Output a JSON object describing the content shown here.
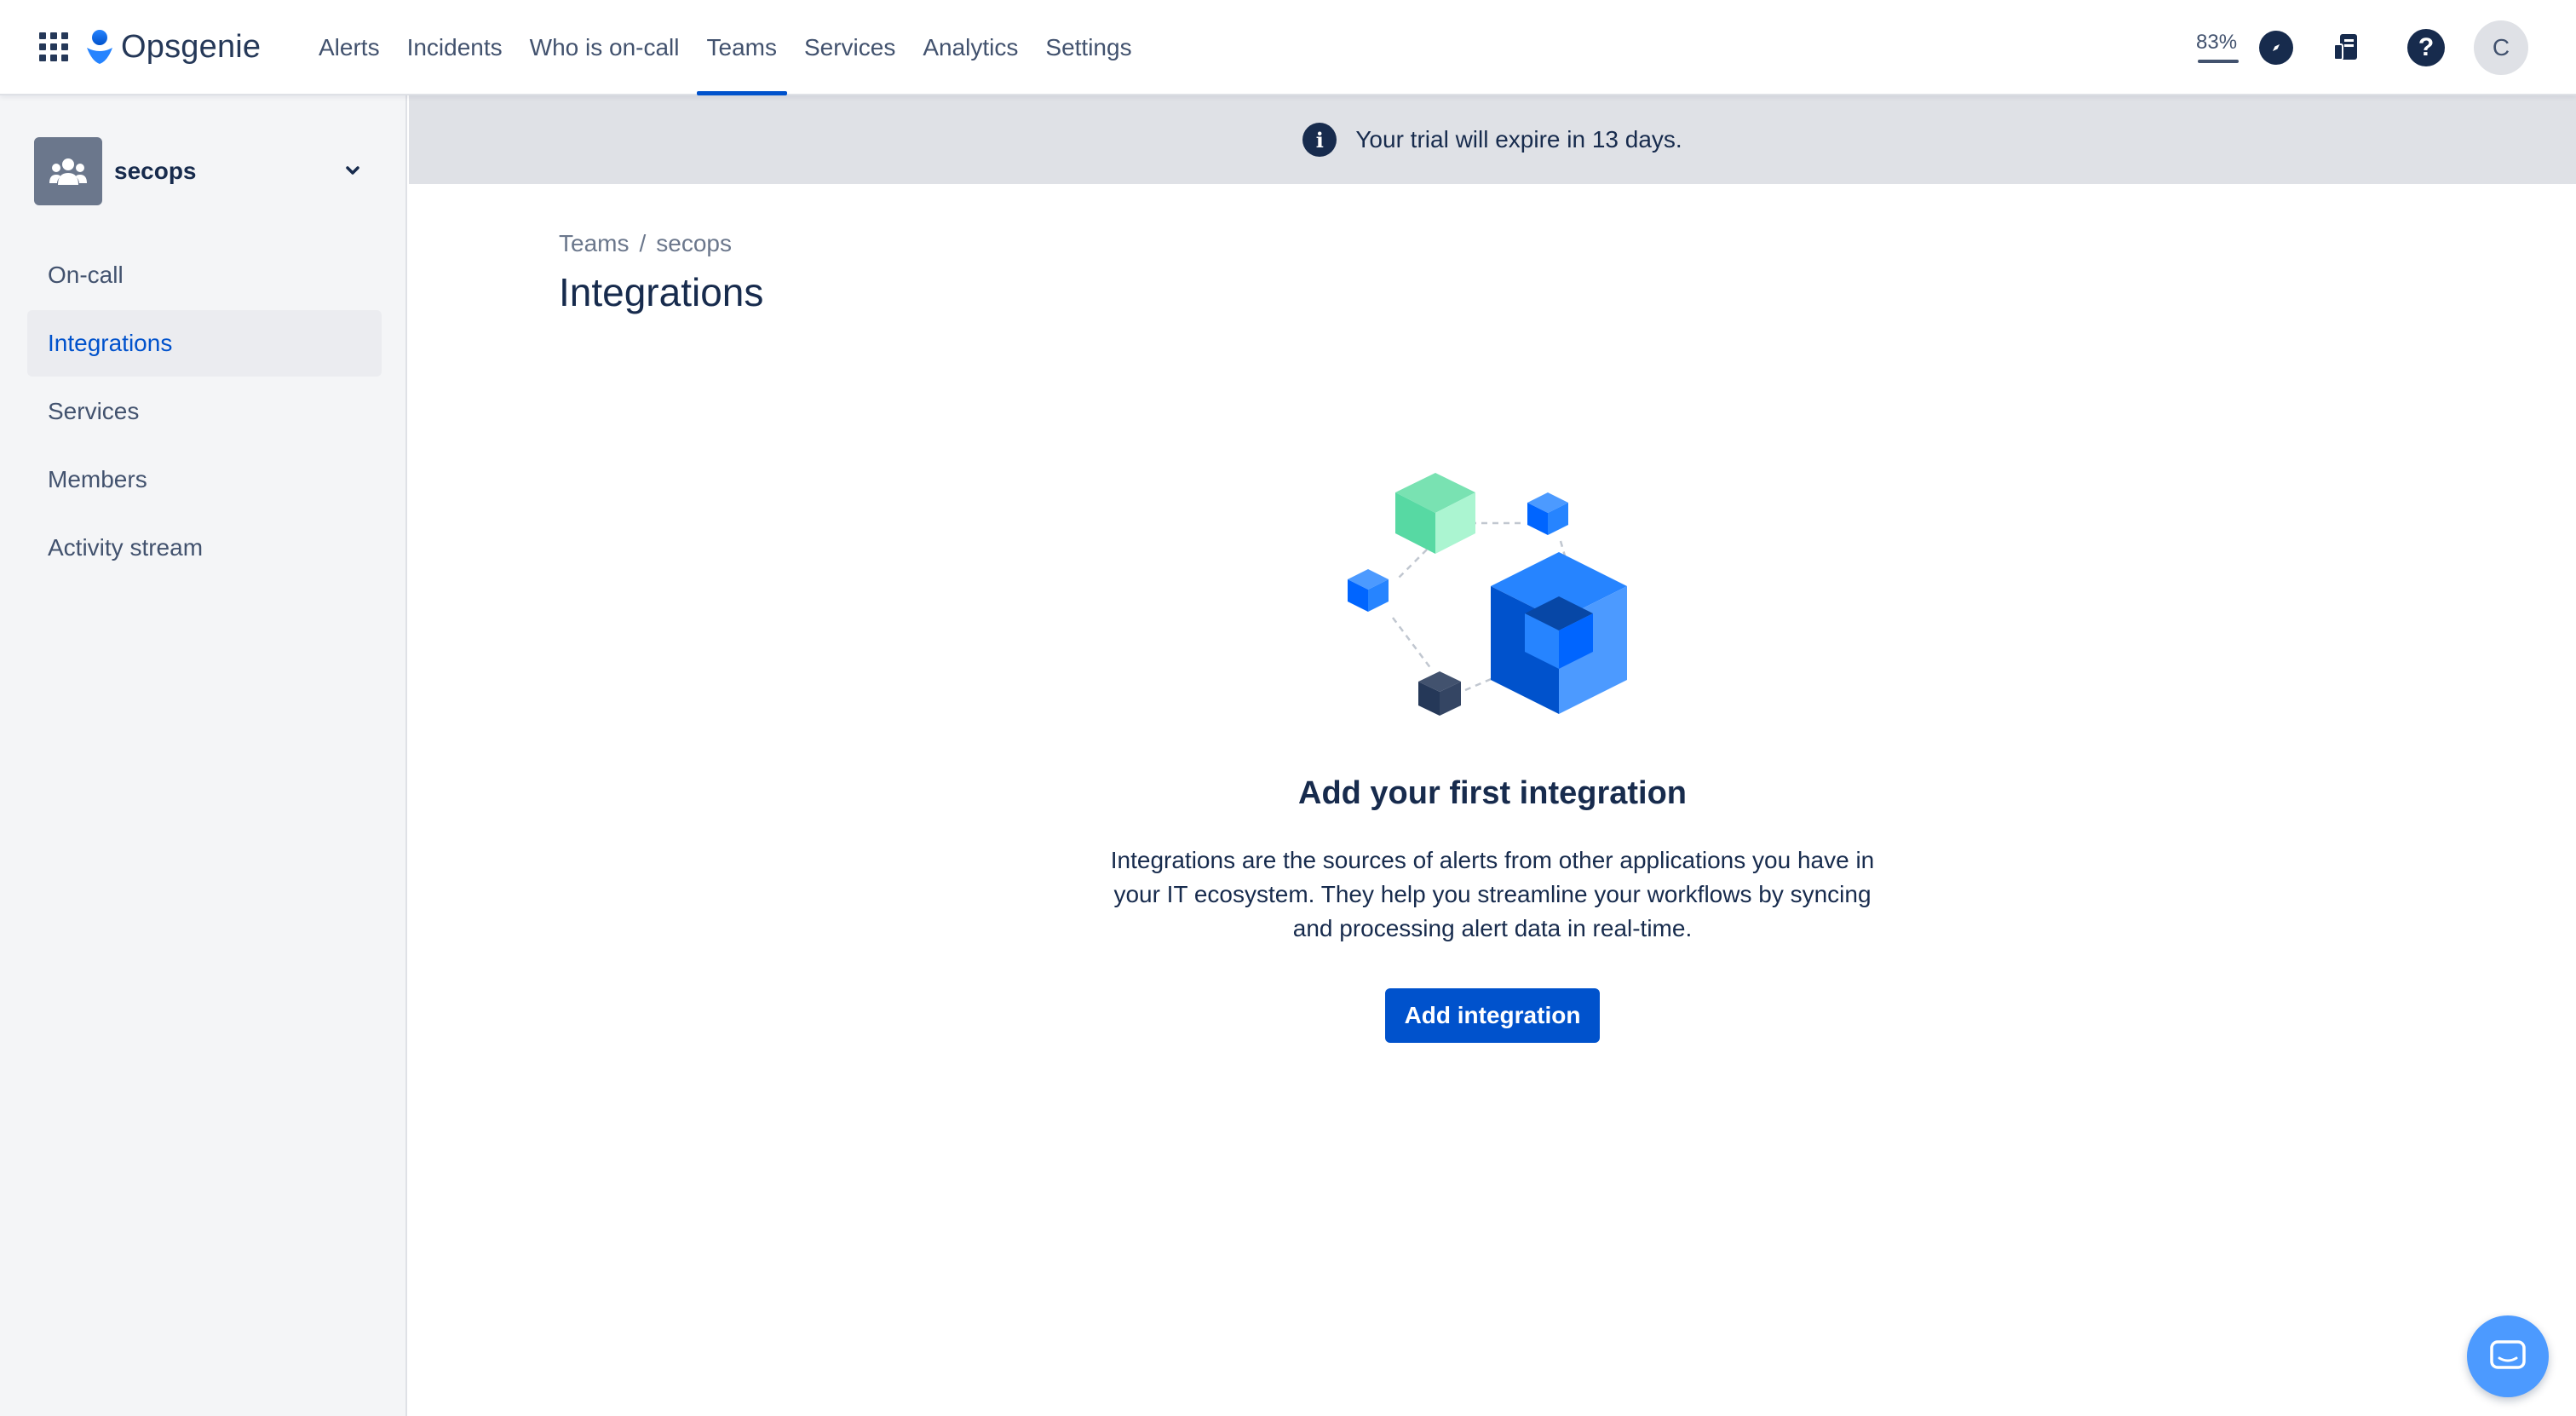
{
  "app": {
    "name": "Opsgenie"
  },
  "nav": {
    "items": [
      {
        "label": "Alerts"
      },
      {
        "label": "Incidents"
      },
      {
        "label": "Who is on-call"
      },
      {
        "label": "Teams",
        "active": true
      },
      {
        "label": "Services"
      },
      {
        "label": "Analytics"
      },
      {
        "label": "Settings"
      }
    ]
  },
  "toolbar": {
    "zoom": "83%",
    "help_glyph": "?",
    "avatar_initial": "C"
  },
  "sidebar": {
    "team_name": "secops",
    "items": [
      {
        "label": "On-call"
      },
      {
        "label": "Integrations",
        "active": true
      },
      {
        "label": "Services"
      },
      {
        "label": "Members"
      },
      {
        "label": "Activity stream"
      }
    ]
  },
  "banner": {
    "icon_glyph": "i",
    "text": "Your trial will expire in 13 days."
  },
  "breadcrumb": {
    "root": "Teams",
    "separator": "/",
    "current": "secops"
  },
  "page": {
    "title": "Integrations"
  },
  "empty_state": {
    "title": "Add your first integration",
    "description": "Integrations are the sources of alerts from other applications you have in your IT ecosystem. They help you streamline your workflows by syncing and processing alert data in real-time.",
    "button_label": "Add integration"
  },
  "colors": {
    "brand": "#0052CC",
    "sidebar_bg": "#F4F5F7",
    "banner_bg": "#DFE1E6",
    "text": "#172B4D",
    "chat_button": "#4C9AFF"
  },
  "icons": [
    "app-switcher-icon",
    "opsgenie-logo-icon",
    "compass-icon",
    "feed-icon",
    "help-icon",
    "team-icon",
    "chevron-down-icon",
    "info-icon",
    "chat-icon"
  ]
}
